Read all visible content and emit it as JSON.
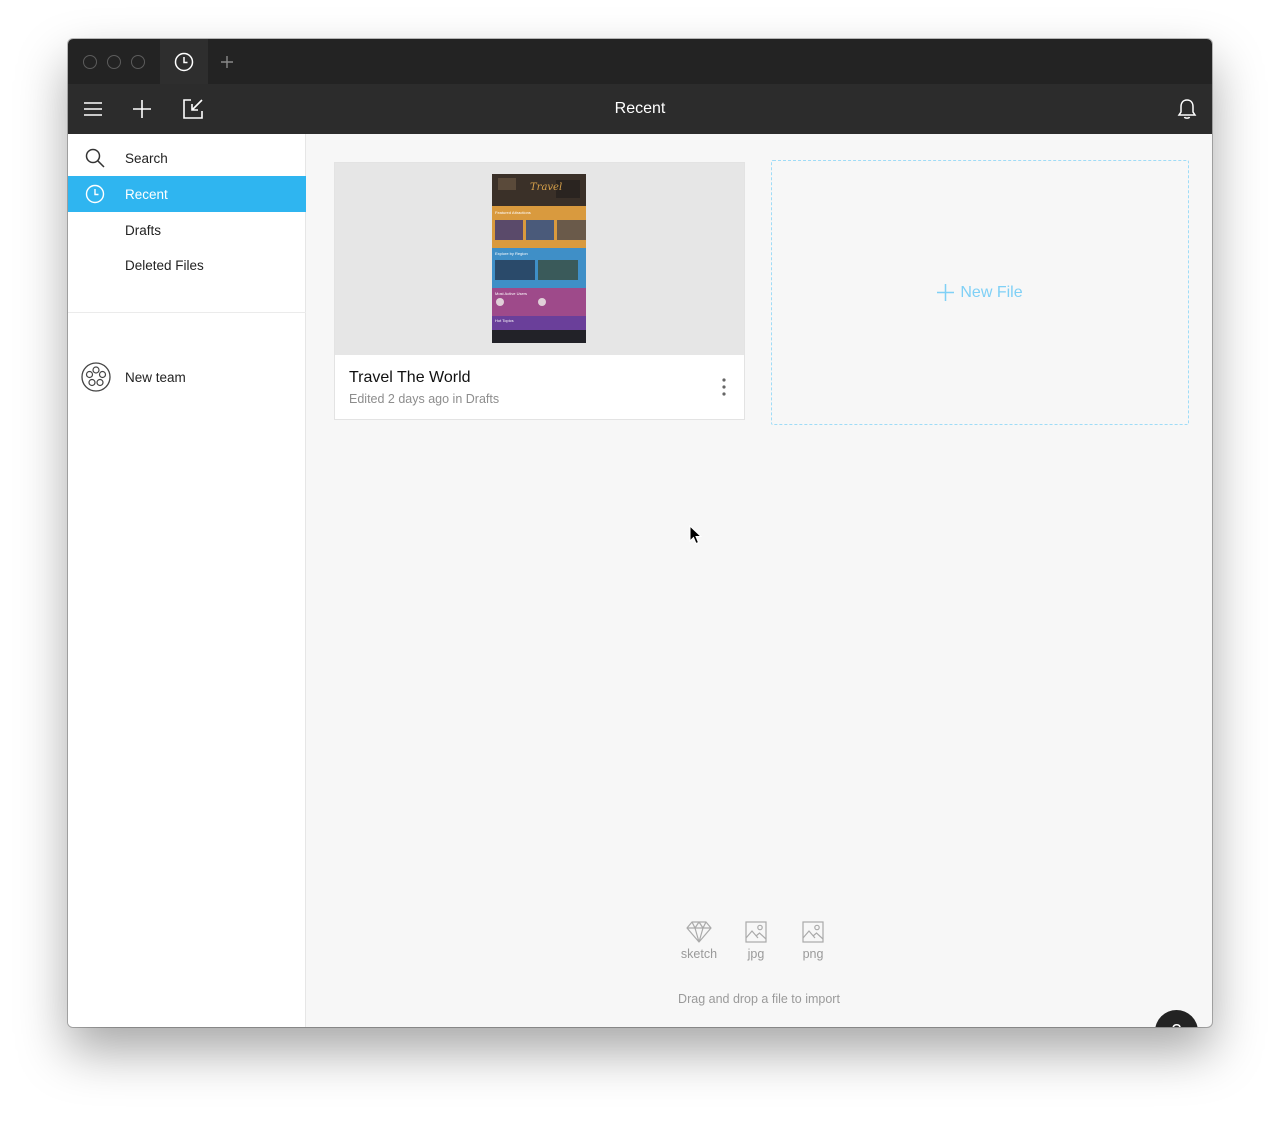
{
  "titlebar": {
    "tab_icon": "clock-icon",
    "add_tab_icon": "plus-icon"
  },
  "toolbar": {
    "title": "Recent",
    "menu_icon": "hamburger-menu-icon",
    "new_icon": "plus-icon",
    "import_icon": "import-arrow-icon",
    "bell_icon": "bell-icon"
  },
  "sidebar": {
    "items": [
      {
        "label": "Search",
        "icon": "search-icon",
        "active": false
      },
      {
        "label": "Recent",
        "icon": "clock-icon",
        "active": true
      },
      {
        "label": "Drafts",
        "icon": "",
        "active": false
      },
      {
        "label": "Deleted Files",
        "icon": "",
        "active": false
      }
    ],
    "team": {
      "label": "New team",
      "icon": "team-circle-icon"
    }
  },
  "main": {
    "file_card": {
      "title": "Travel The World",
      "subtitle": "Edited 2 days ago in Drafts",
      "thumb_title": "Travel",
      "thumb_sections": [
        "Featured Attractions",
        "Explore by Region",
        "Most Active Users",
        "Hot Topics"
      ]
    },
    "new_file": {
      "label": "New File"
    },
    "import": {
      "formats": [
        {
          "label": "sketch",
          "icon": "sketch-diamond-icon"
        },
        {
          "label": "jpg",
          "icon": "image-icon"
        },
        {
          "label": "png",
          "icon": "image-icon"
        }
      ],
      "hint": "Drag and drop a file to import"
    },
    "help": {
      "label": "?"
    }
  },
  "colors": {
    "accent": "#2fb5f0",
    "titlebar": "#232323",
    "toolbar": "#2c2c2c",
    "new_file": "#7fd0f6"
  }
}
